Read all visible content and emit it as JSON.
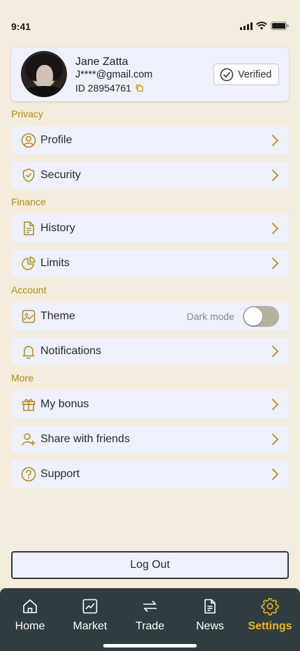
{
  "status": {
    "time": "9:41"
  },
  "profile": {
    "name": "Jane Zatta",
    "email": "J****@gmail.com",
    "id": "ID 28954761",
    "verified_label": "Verified"
  },
  "sections": {
    "privacy": "Privacy",
    "finance": "Finance",
    "account": "Account",
    "more": "More"
  },
  "rows": {
    "profile": "Profile",
    "security": "Security",
    "history": "History",
    "limits": "Limits",
    "theme": "Theme",
    "dark_mode": "Dark mode",
    "notifications": "Notifications",
    "bonus": "My bonus",
    "share": "Share with friends",
    "support": "Support"
  },
  "theme_toggle_on": false,
  "logout_label": "Log Out",
  "tabs": [
    {
      "label": "Home",
      "icon": "home-icon"
    },
    {
      "label": "Market",
      "icon": "chart-icon"
    },
    {
      "label": "Trade",
      "icon": "swap-icon"
    },
    {
      "label": "News",
      "icon": "document-icon"
    },
    {
      "label": "Settings",
      "icon": "gear-icon",
      "active": true
    }
  ],
  "colors": {
    "background": "#f4ecdc",
    "card": "#eef0fb",
    "accent": "#b38b12",
    "tab_bar": "#2f3d40",
    "tab_active": "#f2b51c"
  }
}
